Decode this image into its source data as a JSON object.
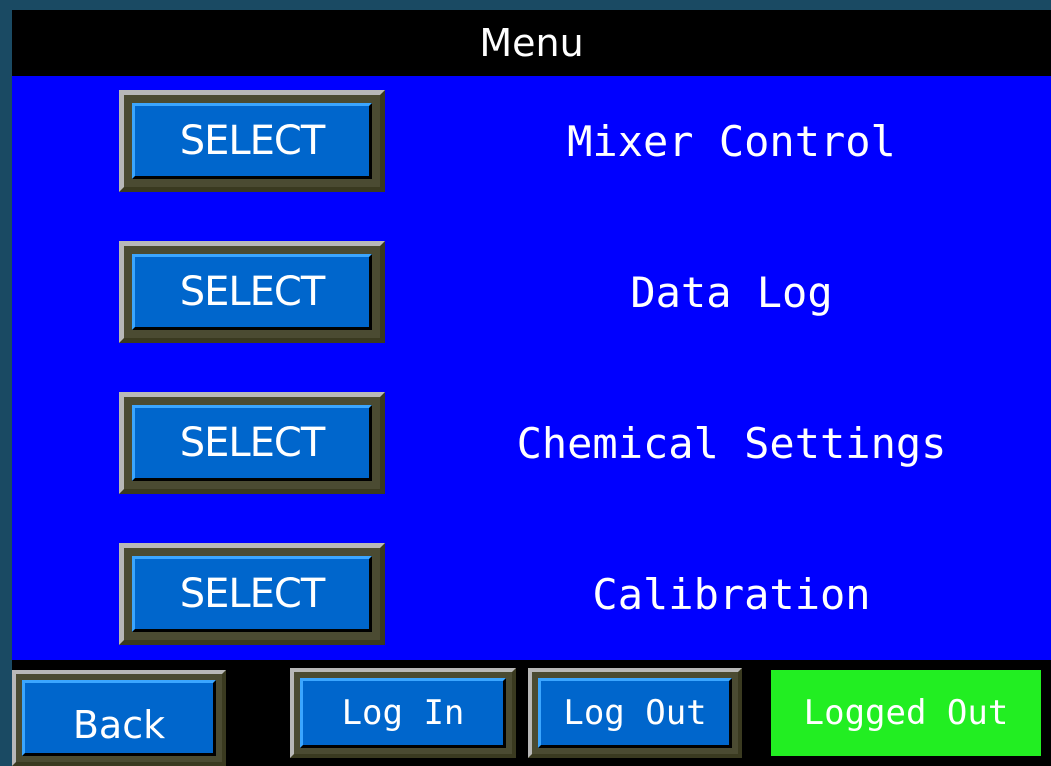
{
  "title": "Menu",
  "menu": {
    "items": [
      {
        "button_label": "SELECT",
        "label": "Mixer Control"
      },
      {
        "button_label": "SELECT",
        "label": "Data Log"
      },
      {
        "button_label": "SELECT",
        "label": "Chemical Settings"
      },
      {
        "button_label": "SELECT",
        "label": "Calibration"
      }
    ]
  },
  "footer": {
    "back_label": "Back",
    "login_label": "Log In",
    "logout_label": "Log Out",
    "status_text": "Logged Out"
  },
  "colors": {
    "panel_background": "#0000ff",
    "button_face": "#0066cc",
    "status_background": "#22ee22",
    "outer_background": "#1a4a63"
  }
}
